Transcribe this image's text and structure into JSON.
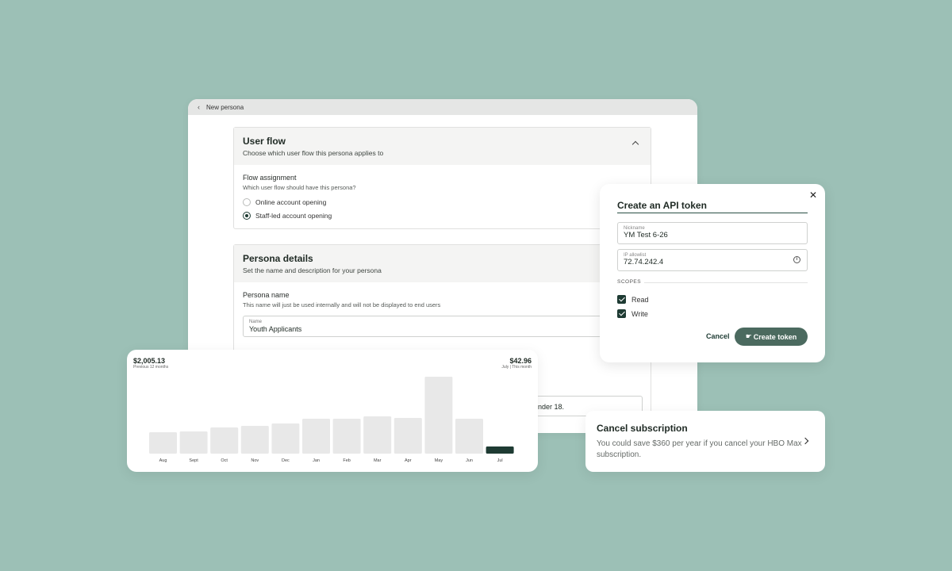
{
  "persona_window": {
    "breadcrumb": "New persona",
    "user_flow": {
      "title": "User flow",
      "subtitle": "Choose which user flow this persona applies to",
      "field_label": "Flow assignment",
      "field_help": "Which user flow should have this persona?",
      "options": [
        {
          "label": "Online account opening",
          "checked": false
        },
        {
          "label": "Staff-led account opening",
          "checked": true
        }
      ]
    },
    "persona_details": {
      "title": "Persona details",
      "subtitle": "Set the name and description for your persona",
      "name_label": "Persona name",
      "name_help": "This name will just be used internally and will not be displayed to end users",
      "name_field_label": "Name",
      "name_field_value": "Youth Applicants",
      "description_fragment": "nder 18."
    }
  },
  "api_dialog": {
    "title": "Create an API token",
    "close_symbol": "✕",
    "nickname_label": "Nickname",
    "nickname_value": "YM Test 6-26",
    "ip_label": "IP allowlist",
    "ip_value": "72.74.242.4",
    "scopes_label": "SCOPES",
    "scopes": [
      {
        "label": "Read",
        "checked": true
      },
      {
        "label": "Write",
        "checked": true
      }
    ],
    "cancel_label": "Cancel",
    "create_label": "Create token"
  },
  "spending_card": {
    "total_value": "$2,005.13",
    "total_caption": "Previous 12 months",
    "current_value": "$42.96",
    "current_caption": "July | This month",
    "colors": {
      "bar": "#e8e8e8",
      "highlight": "#1e3b33"
    }
  },
  "chart_data": {
    "type": "bar",
    "categories": [
      "Aug",
      "Sept",
      "Oct",
      "Nov",
      "Dec",
      "Jan",
      "Feb",
      "Mar",
      "Apr",
      "May",
      "Jun",
      "Jul"
    ],
    "values": [
      27,
      28,
      33,
      35,
      38,
      44,
      44,
      47,
      45,
      97,
      44,
      9
    ],
    "highlighted_category": "Jul",
    "ylim": [
      0,
      100
    ],
    "grid": false,
    "title": "",
    "xlabel": "",
    "ylabel": ""
  },
  "subscription_card": {
    "title": "Cancel subscription",
    "text": "You could save $360 per year if you cancel your HBO Max subscription."
  }
}
